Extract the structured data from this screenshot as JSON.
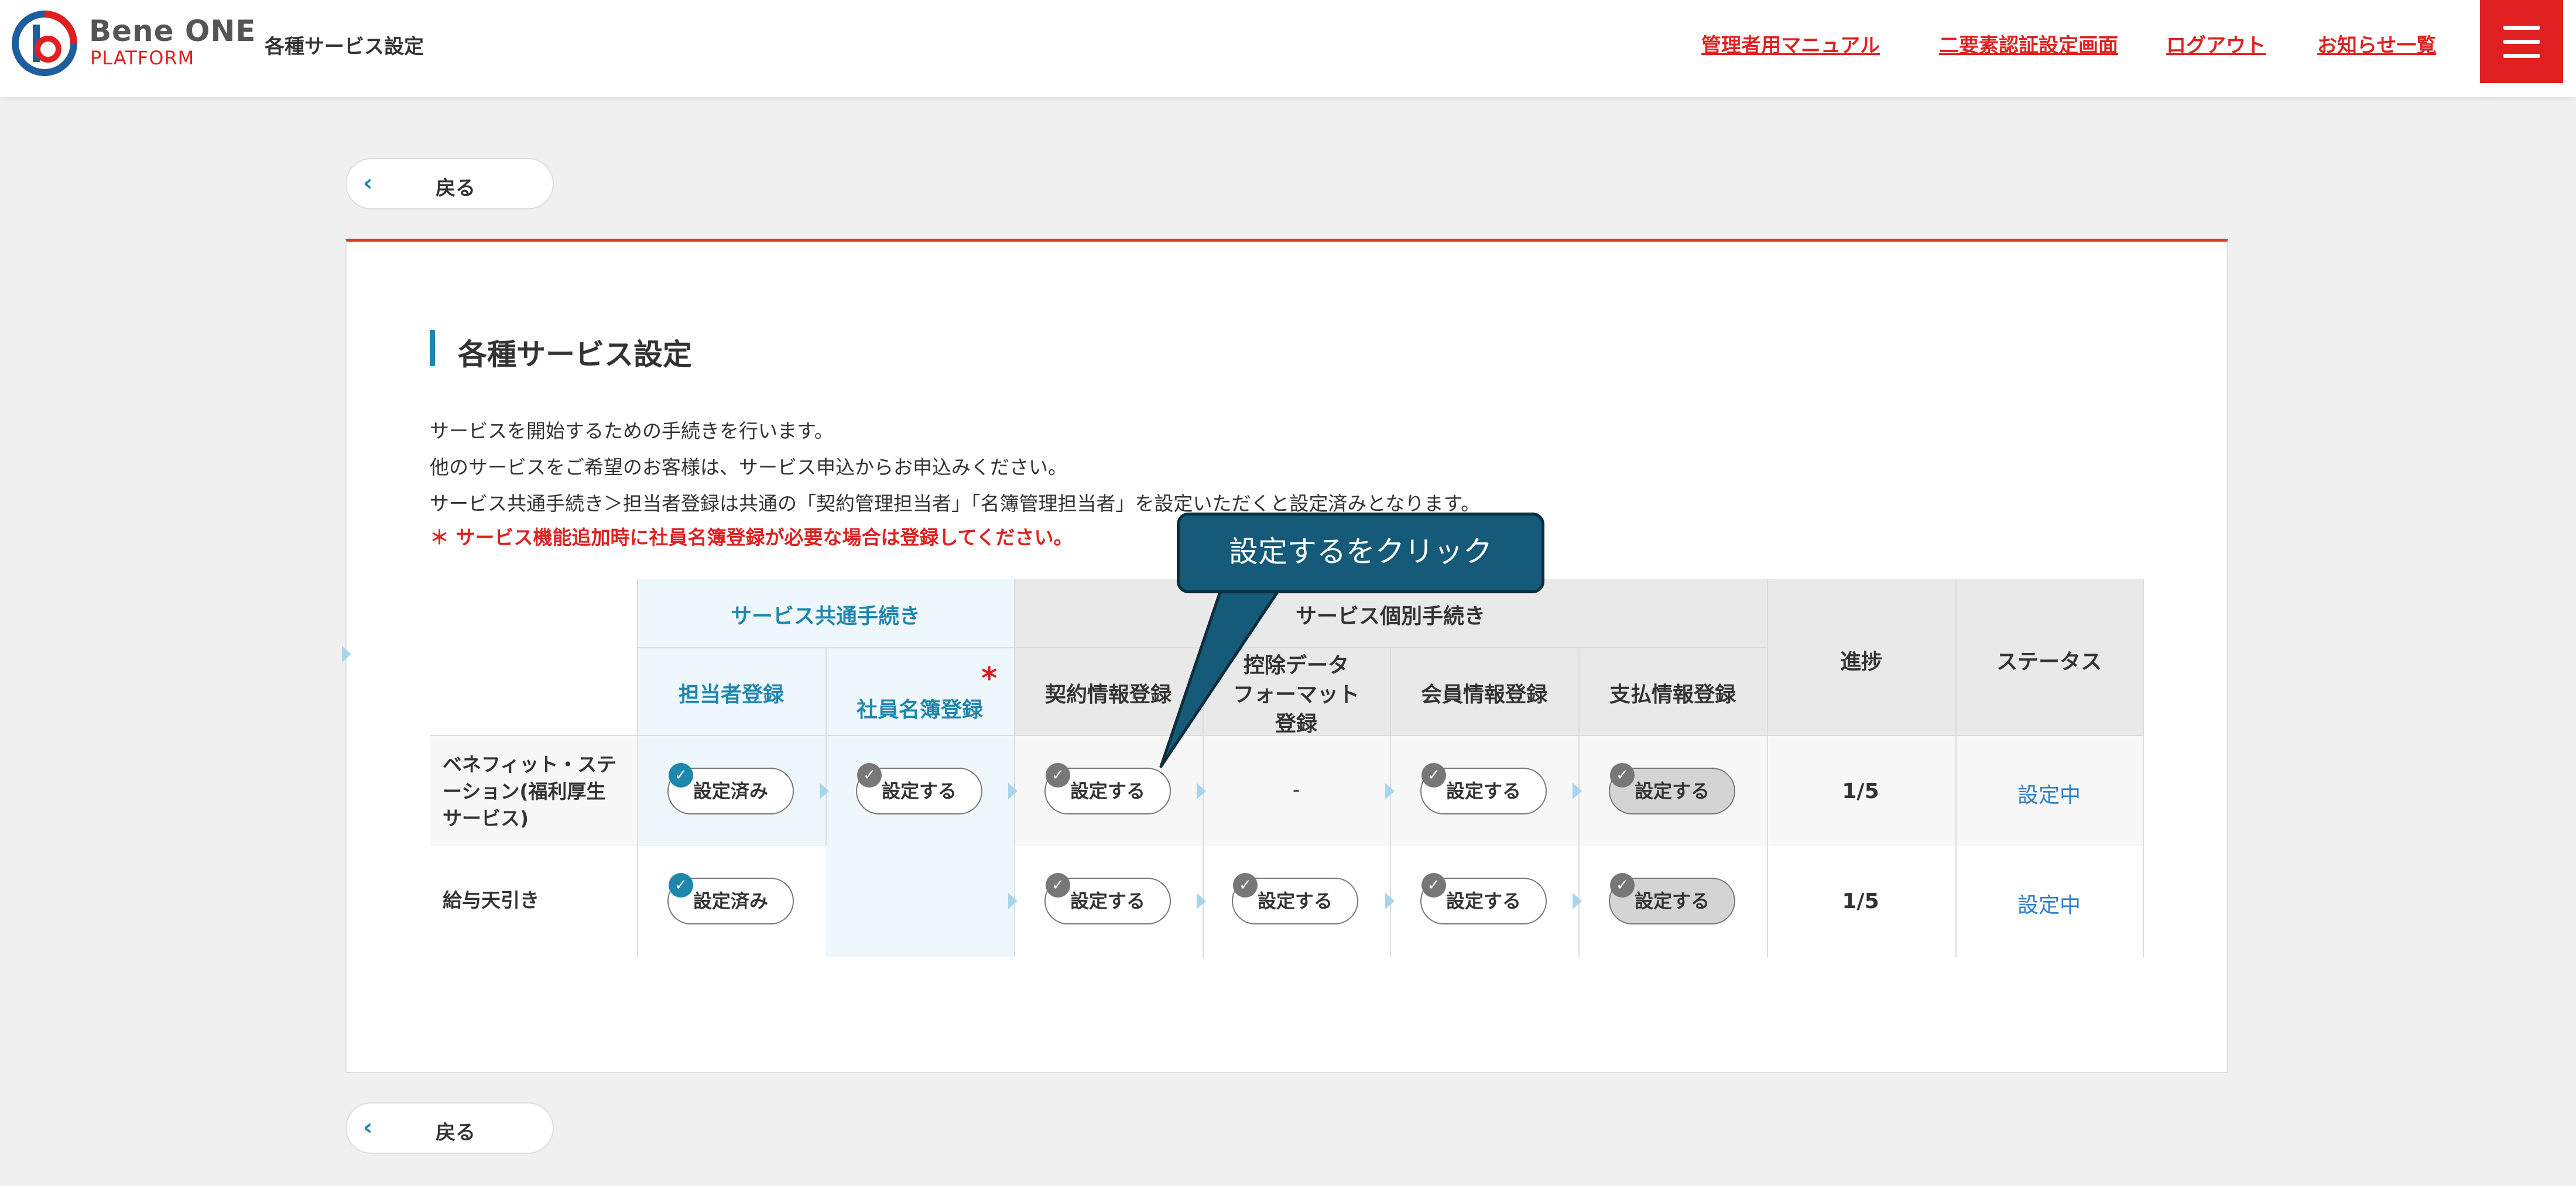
{
  "header": {
    "logo_line1": "Bene ONE",
    "logo_line2": "PLATFORM",
    "title": "各種サービス設定",
    "links": [
      "管理者用マニュアル",
      "二要素認証設定画面",
      "ログアウト",
      "お知らせ一覧"
    ],
    "menu_icon": "hamburger-icon"
  },
  "back_label": "戻る",
  "section": {
    "title": "各種サービス設定",
    "desc": [
      "サービスを開始するための手続きを行います。",
      "他のサービスをご希望のお客様は、サービス申込からお申込みください。",
      "サービス共通手続き＞担当者登録は共通の「契約管理担当者」「名簿管理担当者」を設定いただくと設定済みとなります。"
    ],
    "notice": "＊ サービス機能追加時に社員名簿登録が必要な場合は登録してください。"
  },
  "table": {
    "group_common": "サービス共通手続き",
    "group_individual": "サービス個別手続き",
    "col_tantousha": "担当者登録",
    "col_meibo": "社員名簿登録",
    "required_mark": "*",
    "col_keiyaku": "契約情報登録",
    "col_koujo_1": "控除データ",
    "col_koujo_2": "フォーマット",
    "col_koujo_3": "登録",
    "col_kaiin": "会員情報登録",
    "col_shiharai": "支払情報登録",
    "col_progress": "進捗",
    "col_status": "ステータス",
    "rows": [
      {
        "label_lines": [
          "ベネフィット・ステ",
          "ーション(福利厚生",
          "サービス)"
        ],
        "tantousha": "設定済み",
        "meibo": "設定する",
        "keiyaku": "設定する",
        "koujo": "-",
        "kaiin": "設定する",
        "shiharai": "設定する",
        "progress": "1/5",
        "status": "設定中"
      },
      {
        "label_lines": [
          "給与天引き"
        ],
        "tantousha": "設定済み",
        "keiyaku": "設定する",
        "koujo": "設定する",
        "kaiin": "設定する",
        "shiharai": "設定する",
        "progress": "1/5",
        "status": "設定中"
      }
    ],
    "check_glyph": "✓"
  },
  "callout": {
    "text": "設定するをクリック"
  }
}
